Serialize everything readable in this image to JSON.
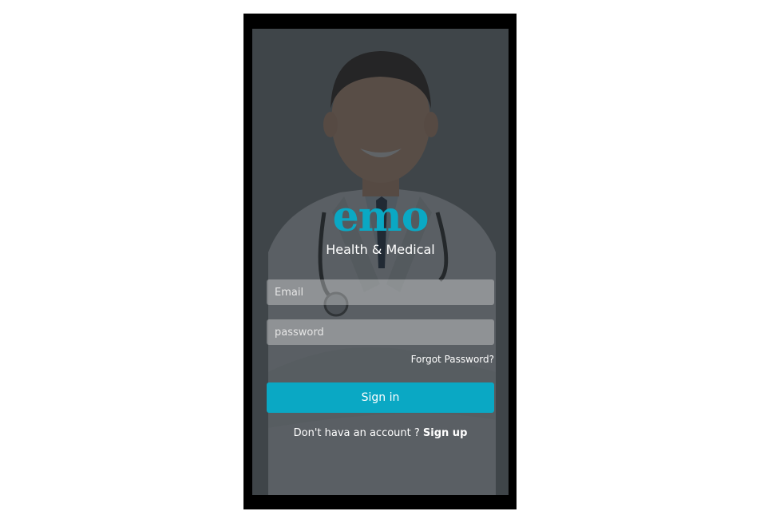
{
  "brand": {
    "logo_text": "emo",
    "tagline": "Health & Medical"
  },
  "form": {
    "email_placeholder": "Email",
    "password_placeholder": "password",
    "forgot_password": "Forgot Password?",
    "signin_label": "Sign in",
    "signup_prompt": "Don't hava an account ? ",
    "signup_link": "Sign up"
  },
  "colors": {
    "accent": "#0aa8c4",
    "overlay": "#23282d"
  },
  "background": {
    "image": "doctor-portrait-photo"
  }
}
